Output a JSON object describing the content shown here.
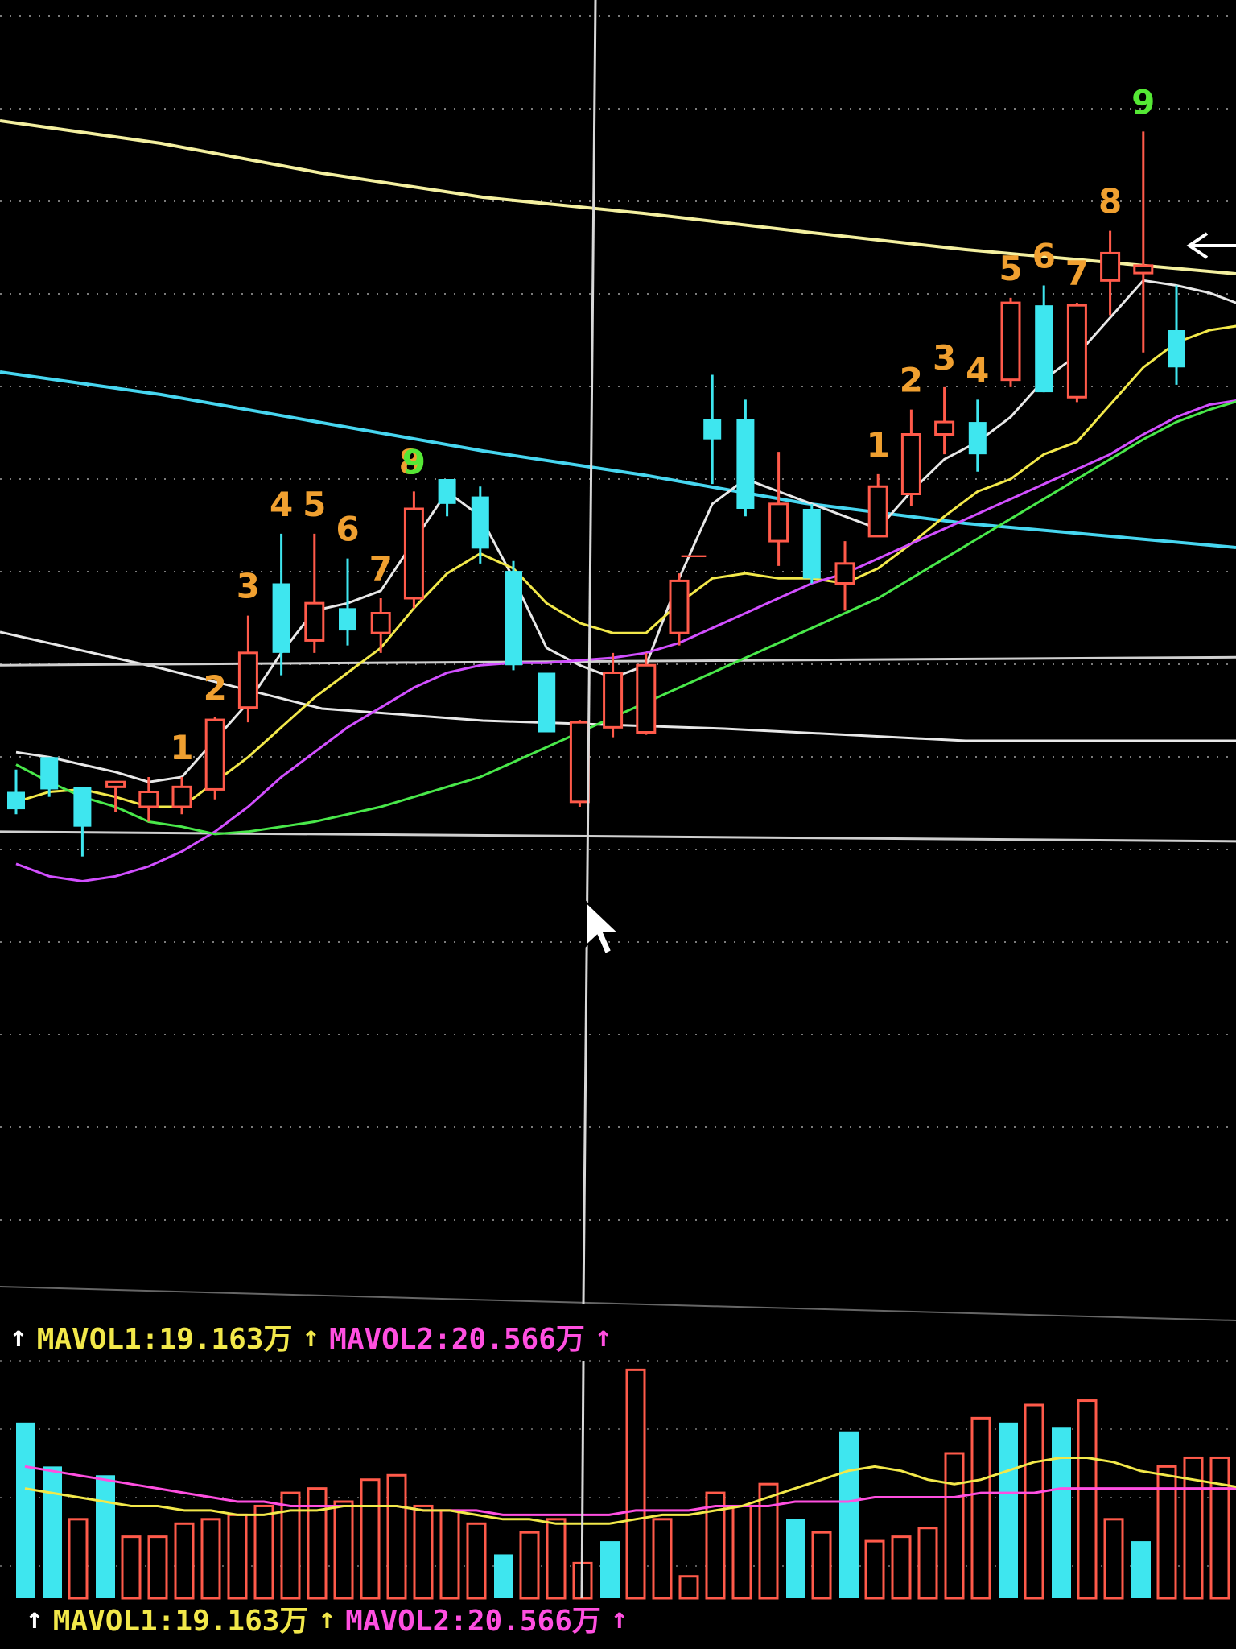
{
  "colors": {
    "background": "#000000",
    "bull": "#ff5a4a",
    "bear": "#3ee6ef",
    "grid": "#9a9a9a",
    "ma_white": "#e8e8e8",
    "ma_yellow": "#f2e84a",
    "ma_purple": "#d24fff",
    "ma_green": "#49e84a",
    "ma_long_yellow": "#f4f0a0",
    "ma_long_cyan": "#47d6f0",
    "count_orange": "#f0a030",
    "count_green": "#55e835",
    "mavol1": "#f2e84a",
    "mavol2": "#ff4fe0"
  },
  "legend": {
    "mavol1_label": "MAVOL1:19.163万",
    "mavol2_label": "MAVOL2:20.566万",
    "arrow": "↑"
  },
  "annotations": {
    "dash": "—",
    "cursor_icon": "mouse-pointer-icon",
    "arrow_icon": "left-arrow-icon"
  },
  "chart_data": {
    "type": "candlestick",
    "x": [
      1,
      2,
      3,
      4,
      5,
      6,
      7,
      8,
      9,
      10,
      11,
      12,
      13,
      14,
      15,
      16,
      17,
      18,
      19,
      20,
      21,
      22,
      23,
      24,
      25,
      26,
      27,
      28,
      29,
      30,
      31,
      32,
      33,
      34,
      35,
      36,
      37,
      38
    ],
    "candles": [
      {
        "i": 1,
        "o": 17,
        "h": 33,
        "c": 24,
        "l": 15,
        "dir": "down"
      },
      {
        "i": 2,
        "o": 25,
        "h": 31,
        "c": 38,
        "l": 22,
        "dir": "down"
      },
      {
        "i": 3,
        "o": 10,
        "h": 16,
        "c": 26,
        "l": -2,
        "dir": "down"
      },
      {
        "i": 4,
        "o": 28,
        "h": 26,
        "c": 26,
        "l": 16,
        "dir": "up"
      },
      {
        "i": 5,
        "o": 18,
        "h": 30,
        "c": 24,
        "l": 12,
        "dir": "up"
      },
      {
        "i": 6,
        "o": 18,
        "h": 30,
        "c": 26,
        "l": 15,
        "dir": "up"
      },
      {
        "i": 7,
        "o": 25,
        "h": 54,
        "c": 53,
        "l": 21,
        "dir": "up"
      },
      {
        "i": 8,
        "o": 58,
        "h": 95,
        "c": 80,
        "l": 52,
        "dir": "up"
      },
      {
        "i": 9,
        "o": 108,
        "h": 128,
        "c": 80,
        "l": 71,
        "dir": "down"
      },
      {
        "i": 10,
        "o": 85,
        "h": 128,
        "c": 100,
        "l": 80,
        "dir": "up"
      },
      {
        "i": 11,
        "o": 89,
        "h": 118,
        "c": 98,
        "l": 83,
        "dir": "down"
      },
      {
        "i": 12,
        "o": 88,
        "h": 102,
        "c": 96,
        "l": 80,
        "dir": "up"
      },
      {
        "i": 13,
        "o": 102,
        "h": 145,
        "c": 138,
        "l": 98,
        "dir": "up"
      },
      {
        "i": 14,
        "o": 140,
        "h": 150,
        "c": 150,
        "l": 135,
        "dir": "down"
      },
      {
        "i": 15,
        "o": 143,
        "h": 147,
        "c": 122,
        "l": 116,
        "dir": "down"
      },
      {
        "i": 16,
        "o": 113,
        "h": 117,
        "c": 75,
        "l": 73,
        "dir": "down"
      },
      {
        "i": 17,
        "o": 72,
        "h": 72,
        "c": 48,
        "l": 48,
        "dir": "down"
      },
      {
        "i": 18,
        "o": 20,
        "h": 53,
        "c": 52,
        "l": 18,
        "dir": "up"
      },
      {
        "i": 19,
        "o": 50,
        "h": 80,
        "c": 72,
        "l": 46,
        "dir": "up"
      },
      {
        "i": 20,
        "o": 48,
        "h": 80,
        "c": 75,
        "l": 47,
        "dir": "up"
      },
      {
        "i": 21,
        "o": 88,
        "h": 112,
        "c": 109,
        "l": 83,
        "dir": "up"
      },
      {
        "i": 22,
        "o": 174,
        "h": 192,
        "c": 166,
        "l": 148,
        "dir": "down"
      },
      {
        "i": 23,
        "o": 174,
        "h": 182,
        "c": 138,
        "l": 135,
        "dir": "down"
      },
      {
        "i": 24,
        "o": 125,
        "h": 161,
        "c": 140,
        "l": 115,
        "dir": "up"
      },
      {
        "i": 25,
        "o": 138,
        "h": 140,
        "c": 110,
        "l": 108,
        "dir": "down"
      },
      {
        "i": 26,
        "o": 108,
        "h": 125,
        "c": 116,
        "l": 97,
        "dir": "up"
      },
      {
        "i": 27,
        "o": 127,
        "h": 152,
        "c": 147,
        "l": 127,
        "dir": "up"
      },
      {
        "i": 28,
        "o": 144,
        "h": 178,
        "c": 168,
        "l": 139,
        "dir": "up"
      },
      {
        "i": 29,
        "o": 168,
        "h": 187,
        "c": 173,
        "l": 160,
        "dir": "up"
      },
      {
        "i": 30,
        "o": 173,
        "h": 182,
        "c": 160,
        "l": 153,
        "dir": "down"
      },
      {
        "i": 31,
        "o": 190,
        "h": 223,
        "c": 221,
        "l": 187,
        "dir": "up"
      },
      {
        "i": 32,
        "o": 220,
        "h": 228,
        "c": 185,
        "l": 185,
        "dir": "down"
      },
      {
        "i": 33,
        "o": 183,
        "h": 221,
        "c": 220,
        "l": 181,
        "dir": "up"
      },
      {
        "i": 34,
        "o": 230,
        "h": 250,
        "c": 241,
        "l": 216,
        "dir": "up"
      },
      {
        "i": 35,
        "o": 233,
        "h": 290,
        "c": 236,
        "l": 201,
        "dir": "up"
      },
      {
        "i": 36,
        "o": 210,
        "h": 228,
        "c": 195,
        "l": 188,
        "dir": "down"
      }
    ],
    "counts": [
      {
        "i": 6,
        "label": "1",
        "color": "orange"
      },
      {
        "i": 7,
        "label": "2",
        "color": "orange"
      },
      {
        "i": 8,
        "label": "3",
        "color": "orange"
      },
      {
        "i": 9,
        "label": "4",
        "color": "orange"
      },
      {
        "i": 10,
        "label": "5",
        "color": "orange"
      },
      {
        "i": 11,
        "label": "6",
        "color": "orange"
      },
      {
        "i": 12,
        "label": "7",
        "color": "orange"
      },
      {
        "i": 12.9,
        "label": "8",
        "color": "orange"
      },
      {
        "i": 13,
        "label": "9",
        "color": "green"
      },
      {
        "i": 27,
        "label": "1",
        "color": "orange"
      },
      {
        "i": 28,
        "label": "2",
        "color": "orange"
      },
      {
        "i": 29,
        "label": "3",
        "color": "orange"
      },
      {
        "i": 30,
        "label": "4",
        "color": "orange"
      },
      {
        "i": 31,
        "label": "5",
        "color": "orange"
      },
      {
        "i": 32,
        "label": "6",
        "color": "orange"
      },
      {
        "i": 33,
        "label": "7",
        "color": "orange"
      },
      {
        "i": 34,
        "label": "8",
        "color": "orange"
      },
      {
        "i": 35,
        "label": "9",
        "color": "green"
      }
    ],
    "series": [
      {
        "key": "white",
        "values": [
          40,
          38,
          35,
          32,
          28,
          30,
          45,
          60,
          80,
          97,
          100,
          105,
          125,
          145,
          135,
          110,
          82,
          75,
          70,
          75,
          110,
          140,
          150,
          145,
          140,
          135,
          130,
          145,
          158,
          165,
          175,
          190,
          200,
          215,
          230,
          228,
          225,
          220
        ]
      },
      {
        "key": "yellow",
        "values": [
          20,
          24,
          25,
          22,
          18,
          18,
          28,
          38,
          50,
          62,
          72,
          82,
          98,
          112,
          120,
          114,
          100,
          92,
          88,
          88,
          100,
          110,
          112,
          110,
          110,
          108,
          114,
          124,
          135,
          145,
          150,
          160,
          165,
          180,
          195,
          205,
          210,
          212
        ]
      },
      {
        "key": "purple",
        "values": [
          -5,
          -10,
          -12,
          -10,
          -6,
          0,
          8,
          18,
          30,
          40,
          50,
          58,
          66,
          72,
          75,
          76,
          76,
          77,
          78,
          80,
          84,
          90,
          96,
          102,
          108,
          112,
          118,
          124,
          130,
          136,
          142,
          148,
          154,
          160,
          168,
          175,
          180,
          182
        ]
      },
      {
        "key": "green",
        "values": [
          35,
          28,
          22,
          18,
          12,
          10,
          7,
          8,
          10,
          12,
          15,
          18,
          22,
          26,
          30,
          36,
          42,
          48,
          54,
          60,
          66,
          72,
          78,
          84,
          90,
          96,
          102,
          110,
          118,
          126,
          134,
          142,
          150,
          158,
          166,
          173,
          178,
          182
        ]
      }
    ],
    "ylim": [
      -30,
      330
    ],
    "horizontal_levels": [
      {
        "key": "level_mid",
        "value": 75
      },
      {
        "key": "level_low",
        "value": 8
      }
    ],
    "volume": {
      "values": [
        40,
        30,
        18,
        28,
        14,
        14,
        17,
        18,
        19,
        21,
        24,
        25,
        22,
        27,
        28,
        21,
        20,
        17,
        10,
        15,
        18,
        8,
        13,
        52,
        18,
        5,
        24,
        21,
        26,
        18,
        15,
        38,
        13,
        14,
        16,
        33,
        41,
        40,
        44,
        39,
        45,
        18,
        13,
        30,
        32,
        32,
        19
      ],
      "colors": [
        "bear",
        "bear",
        "bull",
        "bear",
        "bull",
        "bull",
        "bull",
        "bull",
        "bull",
        "bull",
        "bull",
        "bull",
        "bull",
        "bull",
        "bull",
        "bull",
        "bull",
        "bull",
        "bear",
        "bull",
        "bull",
        "bull",
        "bear",
        "bull",
        "bull",
        "bull",
        "bull",
        "bull",
        "bull",
        "bear",
        "bull",
        "bear",
        "bull",
        "bull",
        "bull",
        "bull",
        "bull",
        "bear",
        "bull",
        "bear",
        "bull",
        "bull",
        "bear",
        "bull",
        "bull",
        "bull",
        "bear"
      ],
      "mavol1": [
        25,
        24,
        23,
        22,
        21,
        21,
        20,
        20,
        19,
        19,
        20,
        20,
        21,
        21,
        21,
        20,
        20,
        19,
        18,
        18,
        17,
        17,
        17,
        18,
        19,
        19,
        20,
        21,
        23,
        25,
        27,
        29,
        30,
        29,
        27,
        26,
        27,
        29,
        31,
        32,
        32,
        31,
        29,
        28,
        27,
        26,
        25
      ],
      "mavol2": [
        30,
        29,
        28,
        27,
        26,
        25,
        24,
        23,
        22,
        22,
        21,
        21,
        21,
        21,
        21,
        20,
        20,
        20,
        19,
        19,
        19,
        19,
        19,
        20,
        20,
        20,
        21,
        21,
        21,
        22,
        22,
        22,
        23,
        23,
        23,
        23,
        24,
        24,
        24,
        25,
        25,
        25,
        25,
        25,
        25,
        25,
        25
      ]
    }
  }
}
